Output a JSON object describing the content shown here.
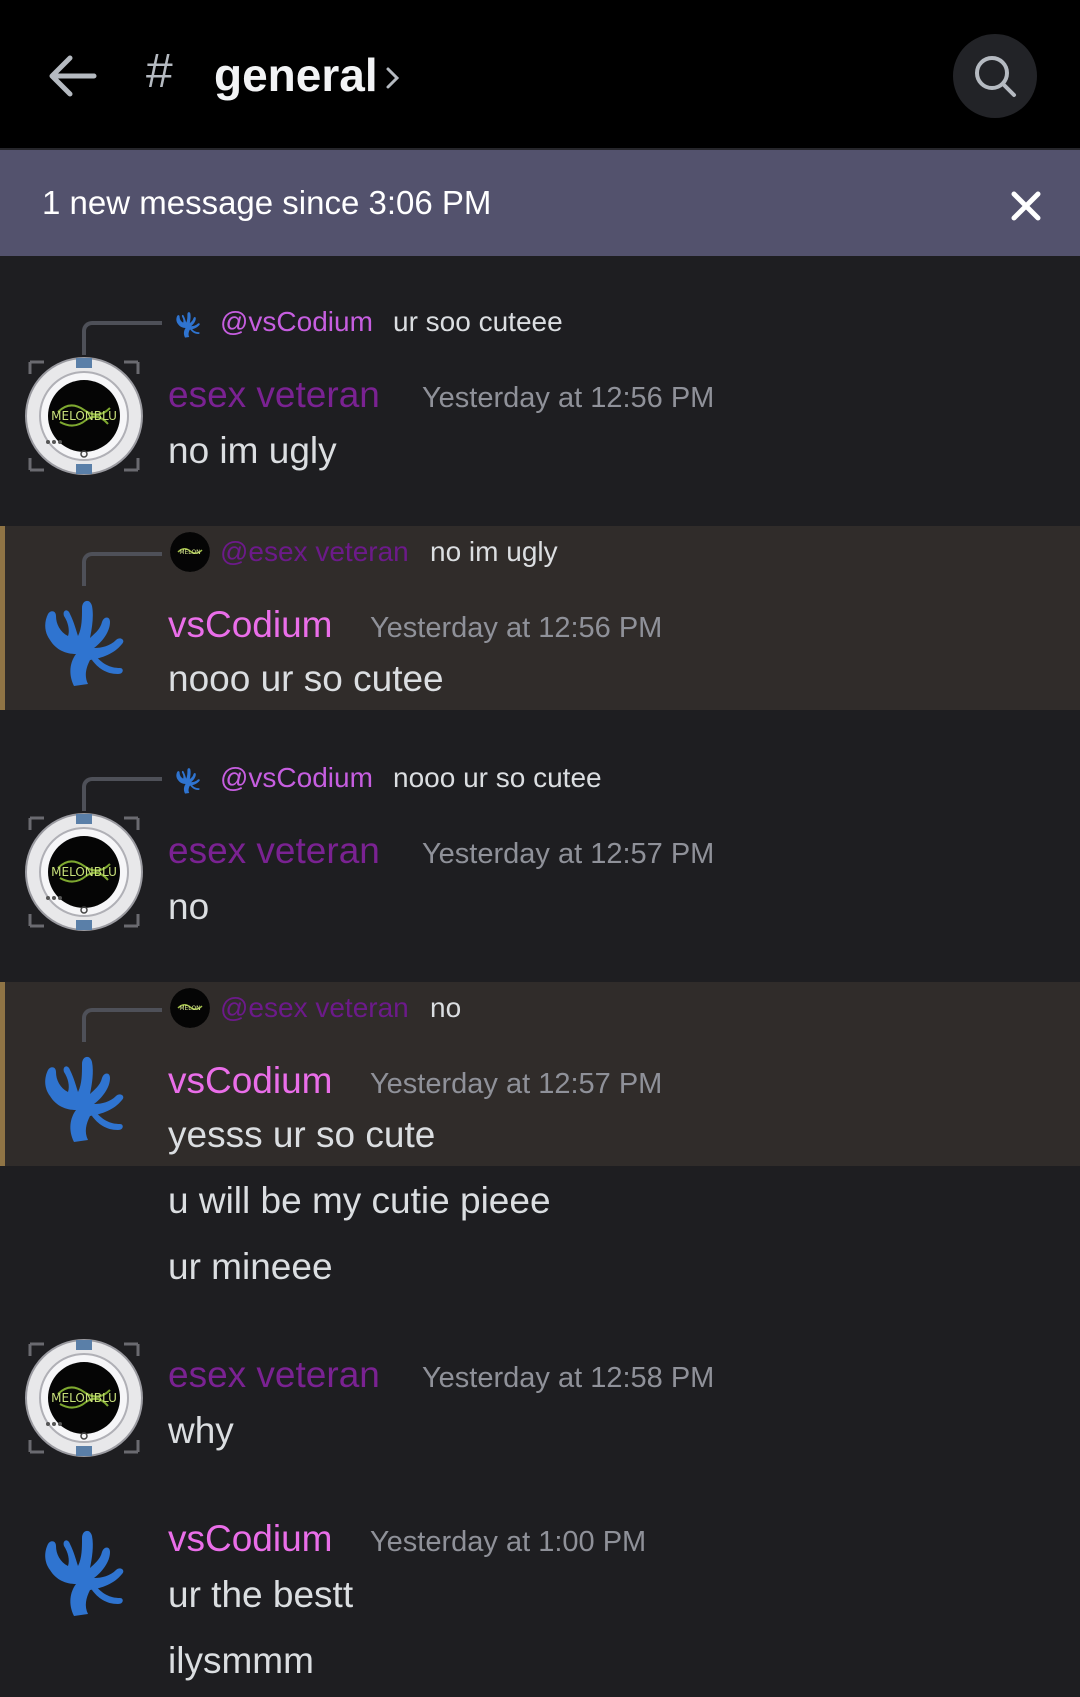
{
  "header": {
    "hash": "#",
    "channel": "general"
  },
  "banner": {
    "text": "1 new message since 3:06 PM"
  },
  "messages": [
    {
      "reply_to": {
        "name": "@vsCodium",
        "text": "ur soo cuteee"
      },
      "author": "esex veteran",
      "timestamp": "Yesterday at 12:56 PM",
      "text": "no im ugly"
    },
    {
      "reply_to": {
        "name": "@esex veteran",
        "text": "no im ugly"
      },
      "author": "vsCodium",
      "timestamp": "Yesterday at 12:56 PM",
      "text": "nooo ur so cutee"
    },
    {
      "reply_to": {
        "name": "@vsCodium",
        "text": "nooo ur so cutee"
      },
      "author": "esex veteran",
      "timestamp": "Yesterday at 12:57 PM",
      "text": "no"
    },
    {
      "reply_to": {
        "name": "@esex veteran",
        "text": "no"
      },
      "author": "vsCodium",
      "timestamp": "Yesterday at 12:57 PM",
      "text": "yesss ur so cute"
    },
    {
      "author": "esex veteran",
      "timestamp": "Yesterday at 12:58 PM",
      "text": "why"
    },
    {
      "author": "vsCodium",
      "timestamp": "Yesterday at 1:00 PM",
      "text": "ur the bestt"
    }
  ],
  "continuations": [
    "u will be my cutie pieee",
    "ur mineee",
    "ilysmmm"
  ],
  "colors": {
    "esex_name": "#7a2292",
    "vs_name": "#ea6ee9",
    "highlight_bg": "#302c2a",
    "banner_bg": "#53526d"
  }
}
